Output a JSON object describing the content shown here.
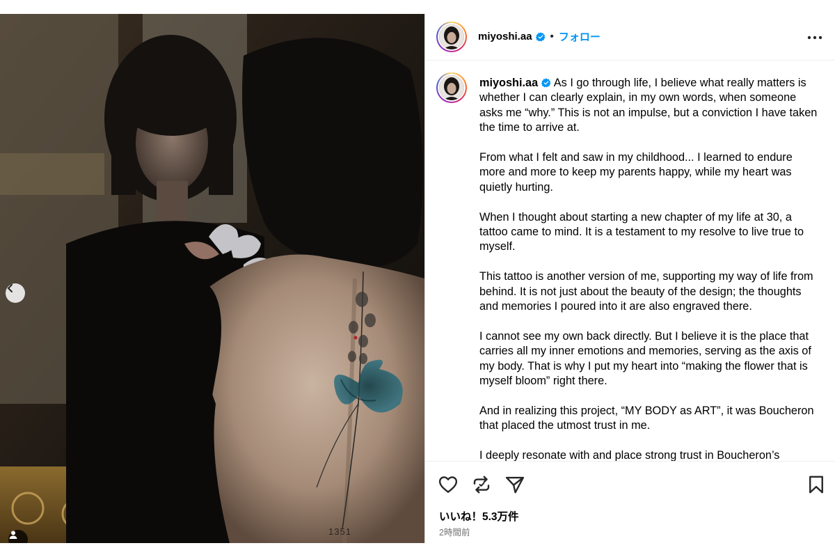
{
  "post": {
    "username": "miyoshi.aa",
    "separator": "•",
    "follow_label": "フォロー",
    "caption_paragraphs": [
      "As I go through life, I believe what really matters is whether I can clearly explain, in my own words, when someone asks me “why.”  This is not an impulse, but a conviction I have taken the time to arrive at.",
      "From what I felt and saw in my childhood... I learned to endure more and more to keep my parents happy, while my heart was quietly hurting.",
      "When I thought about starting a new chapter of my life at 30, a tattoo came to mind. It is a testament to my resolve to live true to myself.",
      "This tattoo is another version of me, supporting my way of life from behind. It is not just about the beauty of the design; the thoughts and memories I poured into it are also engraved there.",
      "I cannot see my own back directly. But I believe it is the place that carries all my inner emotions and memories, serving as the axis of my body. That is why I put my heart into “making the flower that is myself bloom” right there.",
      "And in realizing this project, “MY BODY as ART”, it was Boucheron that placed the utmost trust in me.",
      "I deeply resonate with and place strong trust in Boucheron’s"
    ],
    "likes_text": "いいね！5.3万件",
    "time_text": "2時間前",
    "tattoo_number": "1351"
  },
  "carousel": {
    "count": 4,
    "active_index": 3
  },
  "icons": {
    "verified": "verified-badge-icon",
    "more": "more-options-icon",
    "like": "heart-icon",
    "comment": "comment-icon",
    "repost": "repost-icon",
    "share": "send-icon",
    "save": "bookmark-icon",
    "prev": "chevron-left-icon",
    "user_tag": "user-tag-icon"
  },
  "colors": {
    "accent": "#0095f6",
    "verified": "#0095f6",
    "muted": "#737373"
  }
}
